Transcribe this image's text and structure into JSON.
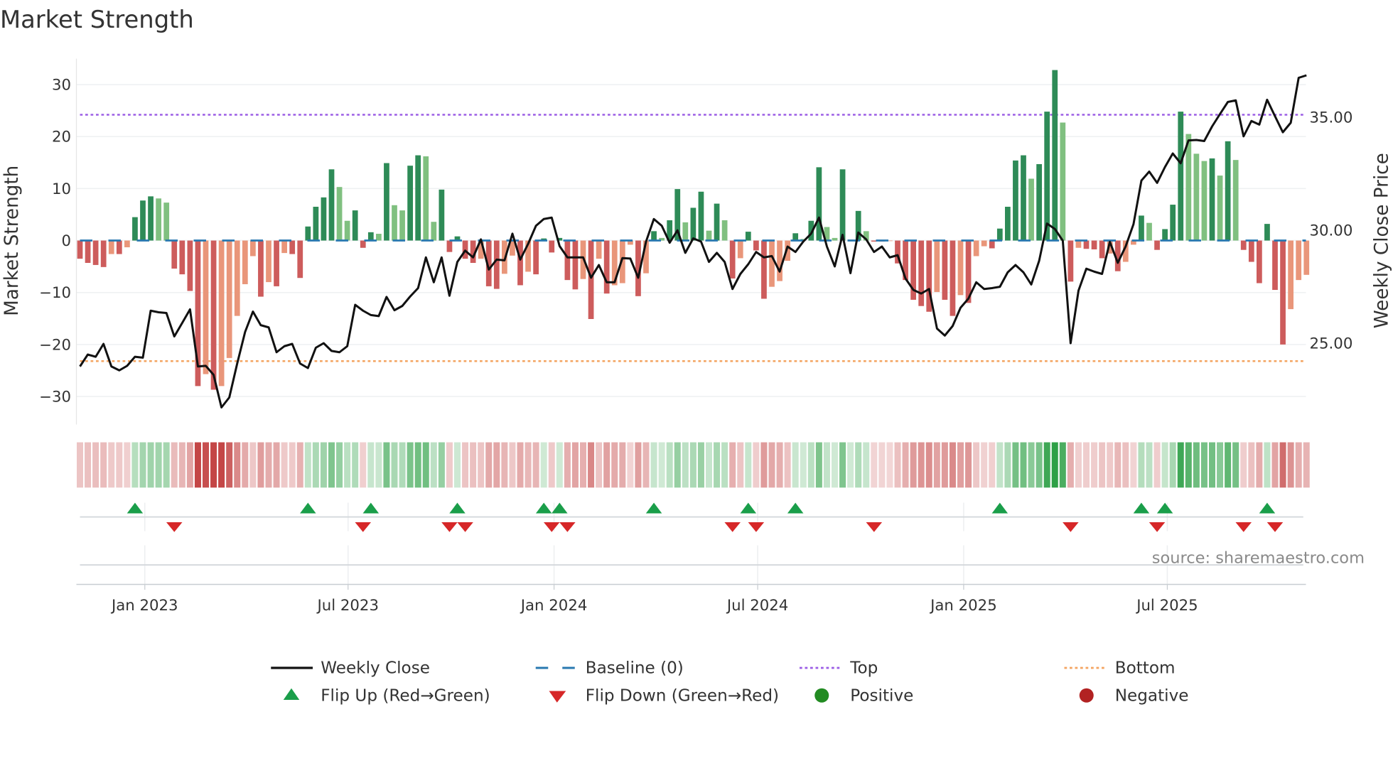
{
  "title": "Market Strength",
  "source": "source: sharemaestro.com",
  "colors": {
    "pos_strong": "#2e8b57",
    "pos_weak": "#80c080",
    "neg_strong": "#cd5c5c",
    "neg_weak": "#e9967a",
    "price": "#111111",
    "baseline": "#2878b0",
    "top": "#9b5de5",
    "bottom": "#f4a460",
    "flip_up": "#1a9e4a",
    "flip_down": "#d62728",
    "positive": "#228b22",
    "negative": "#b22222"
  },
  "legend": {
    "weekly_close": "Weekly Close",
    "baseline": "Baseline (0)",
    "top": "Top",
    "bottom": "Bottom",
    "flip_up": "Flip Up (Red→Green)",
    "flip_down": "Flip Down (Green→Red)",
    "positive": "Positive",
    "negative": "Negative"
  },
  "chart_data": {
    "type": "bar",
    "title": "Market Strength",
    "ylabel": "Market Strength",
    "y2label": "Weekly Close Price",
    "ylim": [
      -35.4,
      35
    ],
    "y2lim": [
      21.4,
      37.6
    ],
    "yticks": [
      -30,
      -20,
      -10,
      0,
      10,
      20,
      30
    ],
    "yticks_labels": [
      "−30",
      "−20",
      "−10",
      "0",
      "10",
      "20",
      "30"
    ],
    "y2ticks": [
      25,
      30,
      35
    ],
    "y2ticks_labels": [
      "25.00",
      "30.00",
      "35.00"
    ],
    "x_unit": "week index",
    "xticks": [
      {
        "week": 8.25,
        "label": "Jan 2023"
      },
      {
        "week": 34.1,
        "label": "Jul 2023"
      },
      {
        "week": 60.3,
        "label": "Jan 2024"
      },
      {
        "week": 86.2,
        "label": "Jul 2024"
      },
      {
        "week": 112.4,
        "label": "Jan 2025"
      },
      {
        "week": 138.3,
        "label": "Jul 2025"
      }
    ],
    "top_level": 24.2,
    "bottom_level": -23.2,
    "baseline": 0,
    "strength": [
      -3.5,
      -4.3,
      -4.7,
      -5.1,
      -2.6,
      -2.6,
      -1.3,
      4.5,
      7.7,
      8.5,
      8.1,
      7.3,
      -5.4,
      -6.5,
      -9.7,
      -28,
      -25.7,
      -28.7,
      -28,
      -22.6,
      -14.5,
      -8.4,
      -3,
      -10.8,
      -8,
      -8.8,
      -2.4,
      -2.6,
      -7.2,
      2.7,
      6.5,
      8.3,
      13.7,
      10.3,
      3.8,
      5.8,
      -1.4,
      1.6,
      1.3,
      14.9,
      6.8,
      5.8,
      14.4,
      16.4,
      16.2,
      3.6,
      9.8,
      -2.2,
      0.8,
      -3.5,
      -4.3,
      -3.5,
      -8.8,
      -9.3,
      -6.4,
      -2.9,
      -8.6,
      -6,
      -6.5,
      0.4,
      -2.3,
      0.5,
      -7.6,
      -9.4,
      -7.4,
      -15.1,
      -3.5,
      -10.2,
      -8.6,
      -8.2,
      -0.8,
      -10.7,
      -6.3,
      1.8,
      0.5,
      3.9,
      9.9,
      3.5,
      6.3,
      9.4,
      1.9,
      7.1,
      3.9,
      -7.3,
      -3.4,
      1.7,
      -1.9,
      -11.2,
      -8.9,
      -7.8,
      -3.9,
      1.4,
      0.3,
      3.8,
      14.1,
      2.6,
      0.5,
      13.7,
      0.2,
      5.7,
      1.8,
      -0.2,
      -0.2,
      -0.1,
      -4.4,
      -7.6,
      -11.4,
      -12.6,
      -13.7,
      -9.9,
      -11.4,
      -14.5,
      -10.5,
      -12,
      -3,
      -1.1,
      -1.5,
      2.3,
      6.5,
      15.4,
      16.4,
      11.9,
      14.7,
      24.8,
      32.8,
      22.7,
      -7.9,
      -1.4,
      -1.6,
      -1.7,
      -3.4,
      -2.5,
      -5.9,
      -4.1,
      -0.8,
      4.8,
      3.4,
      -1.8,
      2.2,
      6.9,
      24.8,
      20.5,
      16.7,
      15.3,
      15.8,
      12.5,
      19.1,
      15.5,
      -1.8,
      -4.1,
      -8.2,
      3.2,
      -9.5,
      -20,
      -13.2,
      -7.6,
      -6.6
    ],
    "weekly_close": [
      23.97,
      24.5,
      24.4,
      24.97,
      23.97,
      23.8,
      24.0,
      24.4,
      24.36,
      26.44,
      26.37,
      26.34,
      25.3,
      25.9,
      26.5,
      23.97,
      24.0,
      23.6,
      22.16,
      22.6,
      24.1,
      25.5,
      26.4,
      25.8,
      25.7,
      24.6,
      24.87,
      24.97,
      24.1,
      23.9,
      24.8,
      25.0,
      24.66,
      24.6,
      24.87,
      26.7,
      26.44,
      26.25,
      26.2,
      27.05,
      26.46,
      26.65,
      27.07,
      27.44,
      28.8,
      27.7,
      28.8,
      27.1,
      28.6,
      29.1,
      28.8,
      29.6,
      28.26,
      28.7,
      28.67,
      29.85,
      28.7,
      29.4,
      30.2,
      30.5,
      30.56,
      29.3,
      28.8,
      28.8,
      28.8,
      27.9,
      28.46,
      27.7,
      27.7,
      28.77,
      28.75,
      27.9,
      29.5,
      30.5,
      30.2,
      29.45,
      30.0,
      29.0,
      29.64,
      29.5,
      28.6,
      29.0,
      28.6,
      27.4,
      28.07,
      28.5,
      29.04,
      28.8,
      28.86,
      28.17,
      29.28,
      29.04,
      29.5,
      29.85,
      30.56,
      29.28,
      28.4,
      29.8,
      28.1,
      29.9,
      29.6,
      29.04,
      29.28,
      28.8,
      28.9,
      27.86,
      27.36,
      27.2,
      27.4,
      25.65,
      25.34,
      25.76,
      26.57,
      26.97,
      27.7,
      27.4,
      27.44,
      27.5,
      28.14,
      28.46,
      28.14,
      27.6,
      28.65,
      30.3,
      30.06,
      29.54,
      25.0,
      27.33,
      28.3,
      28.17,
      28.07,
      29.49,
      28.56,
      29.28,
      30.27,
      32.2,
      32.6,
      32.1,
      32.8,
      33.4,
      32.97,
      33.98,
      34.0,
      33.95,
      34.6,
      35.15,
      35.68,
      35.75,
      34.16,
      34.84,
      34.68,
      35.78,
      35.05,
      34.34,
      34.76,
      36.75,
      36.86
    ],
    "flip_up_weeks": [
      7,
      29,
      37,
      48,
      59,
      61,
      73,
      85,
      91,
      117,
      135,
      138,
      151
    ],
    "flip_down_weeks": [
      12,
      36,
      47,
      49,
      60,
      62,
      83,
      86,
      101,
      126,
      137,
      148,
      152
    ],
    "grid": true,
    "legend_position": "bottom"
  }
}
